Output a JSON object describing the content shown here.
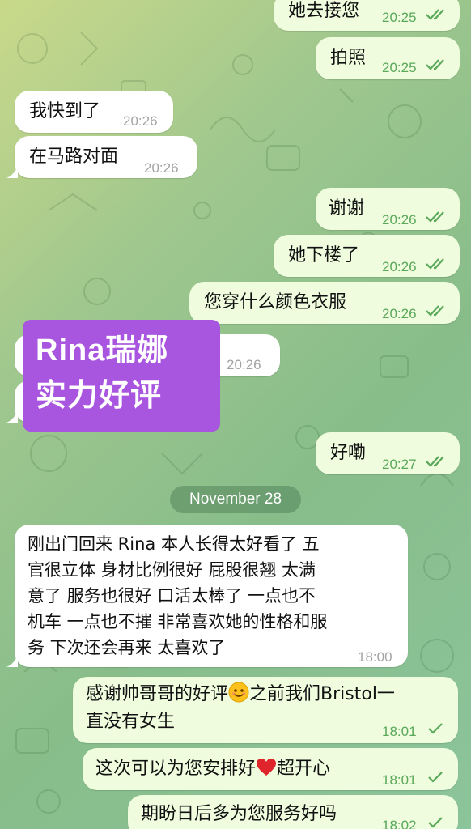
{
  "date_separator": "November 28",
  "overlay": {
    "line1": "Rina瑞娜",
    "line2": "实力好评"
  },
  "messages": [
    {
      "dir": "out",
      "text": "她去接您",
      "time": "20:25",
      "status": "read"
    },
    {
      "dir": "out",
      "text": "拍照",
      "time": "20:25",
      "status": "read"
    },
    {
      "dir": "in",
      "text": "我快到了",
      "time": "20:26"
    },
    {
      "dir": "in",
      "text": "在马路对面",
      "time": "20:26"
    },
    {
      "dir": "out",
      "text": "谢谢",
      "time": "20:26",
      "status": "read"
    },
    {
      "dir": "out",
      "text": "她下楼了",
      "time": "20:26",
      "status": "read"
    },
    {
      "dir": "out",
      "text": "您穿什么颜色衣服",
      "time": "20:26",
      "status": "read"
    },
    {
      "dir": "in",
      "text": "",
      "time": "20:26"
    },
    {
      "dir": "out",
      "text": "好嘞",
      "time": "20:27",
      "status": "read"
    },
    {
      "dir": "in",
      "lines": [
        "刚出门回来 Rina 本人长得太好看了 五",
        "官很立体 身材比例很好 屁股很翘 太满",
        "意了 服务也很好 口活太棒了 一点也不",
        "机车 一点也不摧 非常喜欢她的性格和服",
        "务 下次还会再来 太喜欢了"
      ],
      "time": "18:00"
    },
    {
      "dir": "out",
      "lines": [
        "感谢帅哥哥的好评",
        "之前我们Bristol一",
        "直没有女生"
      ],
      "emoji": "smile",
      "time": "18:01",
      "status": "sent"
    },
    {
      "dir": "out",
      "lines": [
        "这次可以为您安排好",
        "超开心"
      ],
      "emoji": "heart",
      "time": "18:01",
      "status": "sent"
    },
    {
      "dir": "out",
      "text": "期盼日后多为您服务好吗",
      "time": "18:02",
      "status": "sent"
    }
  ],
  "colors": {
    "incoming_bubble": "#ffffff",
    "outgoing_bubble": "#effdde",
    "tick_color": "#5aa85a",
    "overlay": "#a855e0"
  }
}
